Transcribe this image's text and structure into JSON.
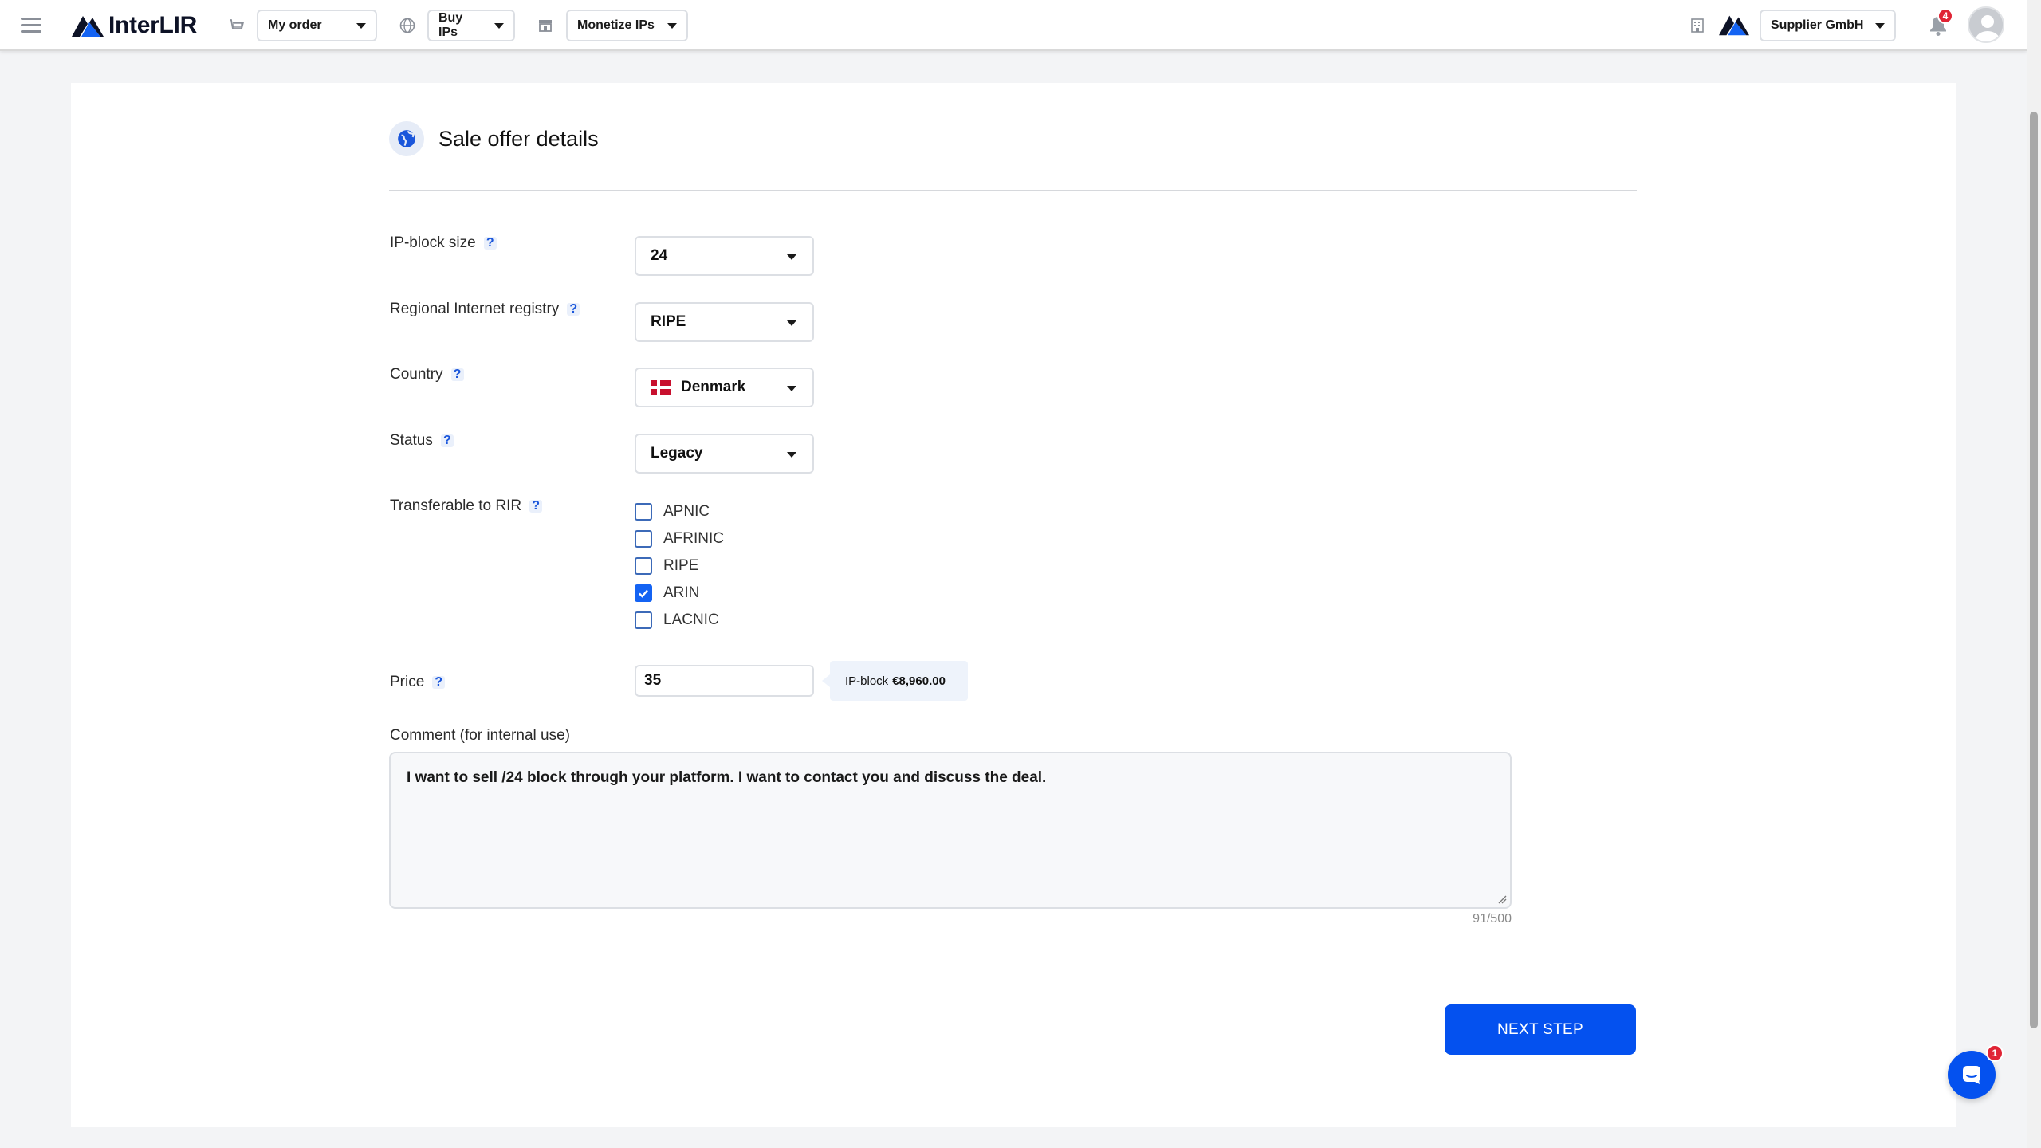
{
  "app": {
    "name": "InterLIR"
  },
  "topbar": {
    "order_label": "My order",
    "buy_label": "Buy IPs",
    "monetize_label": "Monetize IPs",
    "company_label": "Supplier GmbH",
    "notifications_count": "4"
  },
  "section": {
    "title": "Sale offer details"
  },
  "form": {
    "block_size": {
      "label": "IP-block size",
      "value": "24"
    },
    "registry": {
      "label": "Regional Internet registry",
      "value": "RIPE"
    },
    "country": {
      "label": "Country",
      "value": "Denmark"
    },
    "status": {
      "label": "Status",
      "value": "Legacy"
    },
    "transferable": {
      "label": "Transferable to RIR",
      "options": [
        {
          "label": "APNIC",
          "checked": false
        },
        {
          "label": "AFRINIC",
          "checked": false
        },
        {
          "label": "RIPE",
          "checked": false
        },
        {
          "label": "ARIN",
          "checked": true
        },
        {
          "label": "LACNIC",
          "checked": false
        }
      ]
    },
    "price": {
      "label": "Price",
      "value": "35",
      "tip_prefix": "IP-block",
      "tip_amount": "€8,960.00"
    },
    "comment": {
      "label": "Comment (for internal use)",
      "value": "I want to sell /24 block through your platform. I want to contact you and discuss the deal.",
      "counter": "91/500"
    },
    "help_symbol": "?"
  },
  "actions": {
    "next_label": "NEXT STEP"
  },
  "chat": {
    "unread_count": "1"
  },
  "colors": {
    "primary": "#0451ef",
    "help": "#1a56db",
    "badge": "#e02435",
    "page_bg": "#f3f4f6"
  }
}
